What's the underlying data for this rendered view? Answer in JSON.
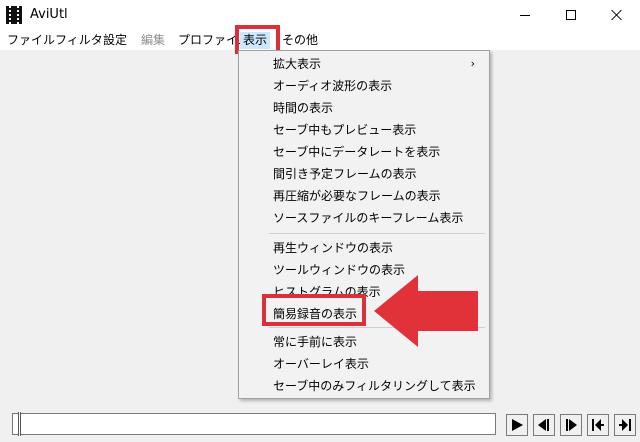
{
  "window": {
    "title": "AviUtl",
    "controls": {
      "minimize": "minimize",
      "maximize": "maximize",
      "close": "close"
    }
  },
  "menubar": {
    "items": [
      {
        "label": "ファイル",
        "state": "normal"
      },
      {
        "label": "フィルタ",
        "state": "normal"
      },
      {
        "label": "設定",
        "state": "normal"
      },
      {
        "label": "編集",
        "state": "disabled"
      },
      {
        "label": "プロファイル",
        "state": "normal"
      },
      {
        "label": "表示",
        "state": "active"
      },
      {
        "label": "その他",
        "state": "normal"
      }
    ]
  },
  "dropdown": {
    "groups": [
      [
        {
          "label": "拡大表示",
          "has_submenu": true
        },
        {
          "label": "オーディオ波形の表示"
        },
        {
          "label": "時間の表示"
        },
        {
          "label": "セーブ中もプレビュー表示"
        },
        {
          "label": "セーブ中にデータレートを表示"
        },
        {
          "label": "間引き予定フレームの表示"
        },
        {
          "label": "再圧縮が必要なフレームの表示"
        },
        {
          "label": "ソースファイルのキーフレーム表示"
        }
      ],
      [
        {
          "label": "再生ウィンドウの表示"
        },
        {
          "label": "ツールウィンドウの表示"
        },
        {
          "label": "ヒストグラムの表示"
        },
        {
          "label": "簡易録音の表示",
          "highlighted": true
        }
      ],
      [
        {
          "label": "常に手前に表示"
        },
        {
          "label": "オーバーレイ表示"
        },
        {
          "label": "セーブ中のみフィルタリングして表示"
        }
      ]
    ],
    "submenu_glyph": "›"
  },
  "annotation": {
    "color": "#d9303a",
    "arrow_icon": "left-arrow-icon"
  },
  "playback": {
    "seek_position": 0,
    "buttons": [
      "play-icon",
      "prev-frame-icon",
      "next-frame-icon",
      "first-frame-icon",
      "last-frame-icon"
    ]
  },
  "colors": {
    "menu_active_bg": "#cce8ff",
    "dropdown_bg": "#f2f2f2",
    "client_bg": "#f0f0f0"
  }
}
